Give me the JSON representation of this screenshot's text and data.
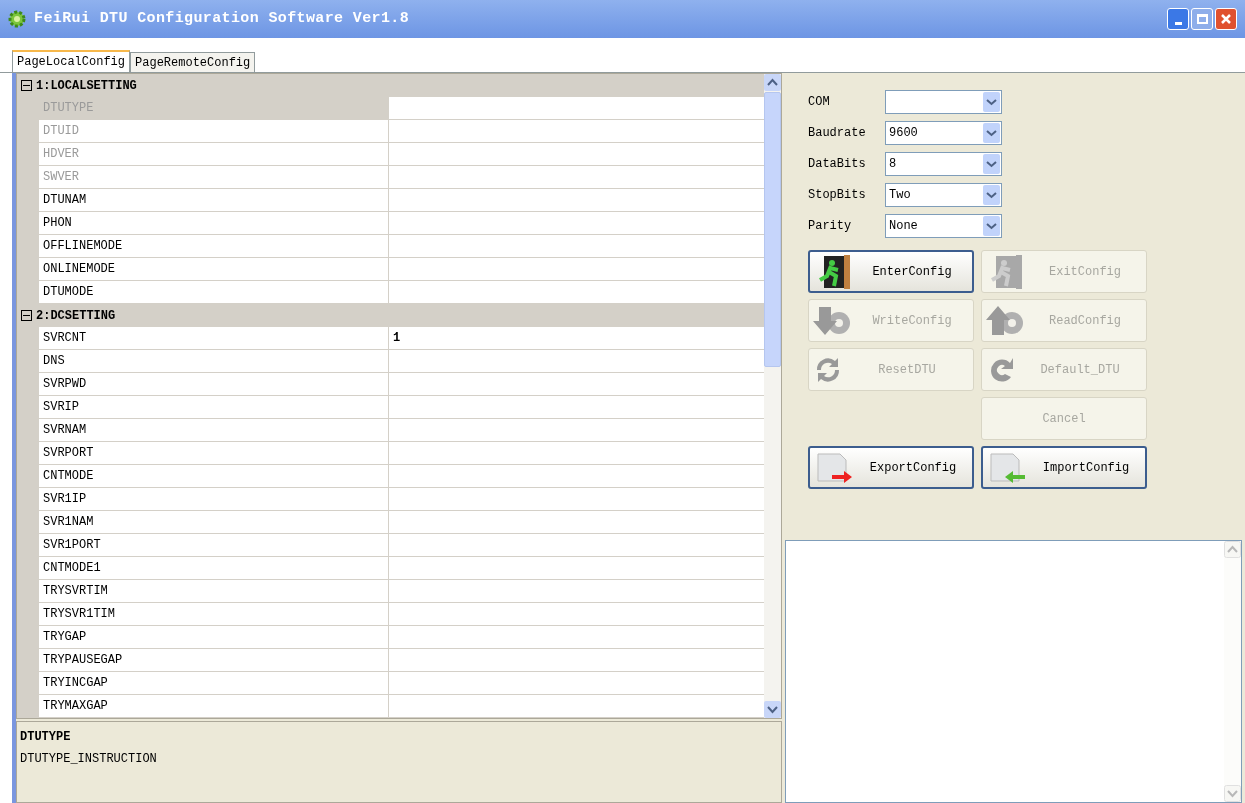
{
  "window": {
    "title": "FeiRui DTU Configuration Software Ver1.8"
  },
  "tabs": [
    {
      "label": "PageLocalConfig",
      "selected": true
    },
    {
      "label": "PageRemoteConfig",
      "selected": false
    }
  ],
  "property_grid": {
    "categories": [
      {
        "title": "1:LOCALSETTING",
        "expanded": true,
        "properties": [
          {
            "name": "DTUTYPE",
            "selected": true,
            "disabled": true
          },
          {
            "name": "DTUID",
            "selected": false,
            "disabled": true
          },
          {
            "name": "HDVER",
            "selected": false,
            "disabled": true
          },
          {
            "name": "SWVER",
            "selected": false,
            "disabled": true
          },
          {
            "name": "DTUNAM",
            "selected": false,
            "disabled": false
          },
          {
            "name": "PHON",
            "selected": false,
            "disabled": false
          },
          {
            "name": "OFFLINEMODE",
            "selected": false,
            "disabled": false
          },
          {
            "name": "ONLINEMODE",
            "selected": false,
            "disabled": false
          },
          {
            "name": "DTUMODE",
            "selected": false,
            "disabled": false
          }
        ]
      },
      {
        "title": "2:DCSETTING",
        "expanded": true,
        "properties": [
          {
            "name": "SVRCNT",
            "value": "1",
            "selected": false,
            "disabled": false
          },
          {
            "name": "DNS",
            "selected": false,
            "disabled": false
          },
          {
            "name": "SVRPWD",
            "selected": false,
            "disabled": false
          },
          {
            "name": "SVRIP",
            "selected": false,
            "disabled": false
          },
          {
            "name": "SVRNAM",
            "selected": false,
            "disabled": false
          },
          {
            "name": "SVRPORT",
            "selected": false,
            "disabled": false
          },
          {
            "name": "CNTMODE",
            "selected": false,
            "disabled": false
          },
          {
            "name": "SVR1IP",
            "selected": false,
            "disabled": false
          },
          {
            "name": "SVR1NAM",
            "selected": false,
            "disabled": false
          },
          {
            "name": "SVR1PORT",
            "selected": false,
            "disabled": false
          },
          {
            "name": "CNTMODE1",
            "selected": false,
            "disabled": false
          },
          {
            "name": "TRYSVRTIM",
            "selected": false,
            "disabled": false
          },
          {
            "name": "TRYSVR1TIM",
            "selected": false,
            "disabled": false
          },
          {
            "name": "TRYGAP",
            "selected": false,
            "disabled": false
          },
          {
            "name": "TRYPAUSEGAP",
            "selected": false,
            "disabled": false
          },
          {
            "name": "TRYINCGAP",
            "selected": false,
            "disabled": false
          },
          {
            "name": "TRYMAXGAP",
            "selected": false,
            "disabled": false
          }
        ]
      }
    ]
  },
  "description": {
    "title": "DTUTYPE",
    "text": "DTUTYPE_INSTRUCTION"
  },
  "serial_settings": [
    {
      "label": "COM"
    },
    {
      "label": "Baudrate",
      "value": "9600"
    },
    {
      "label": "DataBits",
      "value": "8"
    },
    {
      "label": "StopBits",
      "value": "Two"
    },
    {
      "label": "Parity",
      "value": "None"
    }
  ],
  "buttons": [
    {
      "label": "EnterConfig",
      "kind": "enter",
      "disabled": false
    },
    {
      "label": "ExitConfig",
      "kind": "exit",
      "disabled": true
    },
    {
      "label": "WriteConfig",
      "kind": "write",
      "disabled": true
    },
    {
      "label": "ReadConfig",
      "kind": "read",
      "disabled": true
    },
    {
      "label": "ResetDTU",
      "kind": "reset",
      "disabled": true
    },
    {
      "label": "Default_DTU",
      "kind": "default",
      "disabled": true
    },
    {
      "label": "Cancel",
      "kind": "cancel",
      "disabled": true
    },
    {
      "label": "ExportConfig",
      "kind": "export",
      "disabled": false
    },
    {
      "label": "ImportConfig",
      "kind": "import",
      "disabled": false
    }
  ]
}
